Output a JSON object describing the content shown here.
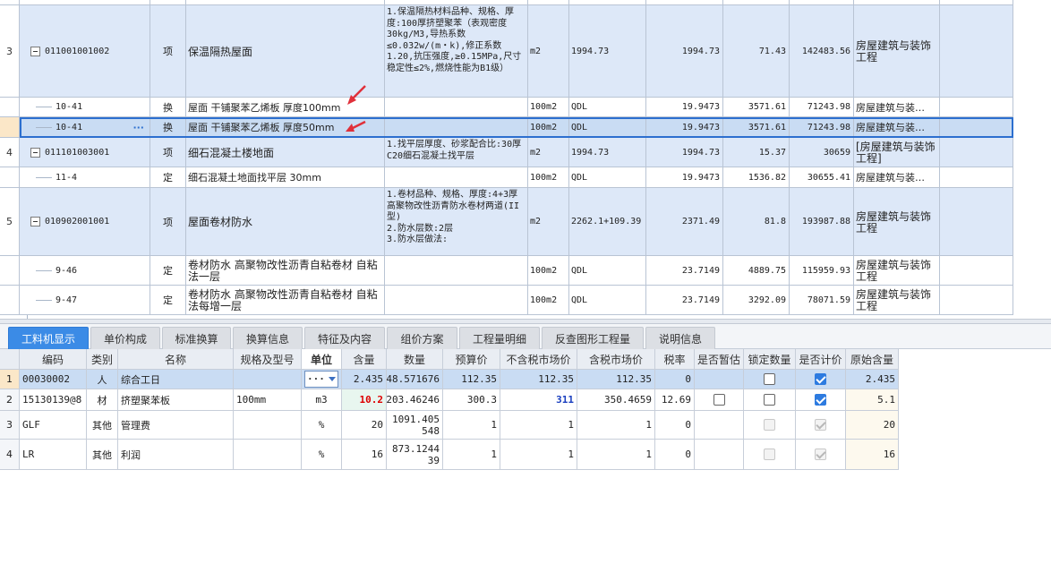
{
  "top_grid": {
    "rows": [
      {
        "idx": "",
        "code": "",
        "type": "",
        "name": "",
        "desc": "",
        "unit": "",
        "qty_expr": "",
        "qty": "",
        "price": "",
        "total": "",
        "major": ""
      },
      {
        "idx": "3",
        "code": "011001001002",
        "type": "项",
        "name": "保温隔热屋面",
        "desc": "1.保温隔热材料品种、规格、厚度:100厚挤塑聚苯（表观密度30kg/M3,导热系数≤0.032w/(m・k),修正系数1.20,抗压强度,≥0.15MPa,尺寸稳定性≤2%,燃烧性能为B1级）",
        "unit": "m2",
        "qty_expr": "1994.73",
        "qty": "1994.73",
        "price": "71.43",
        "total": "142483.56",
        "major": "房屋建筑与装饰工程"
      },
      {
        "idx": "",
        "code": "10-41",
        "type": "换",
        "name": "屋面 干铺聚苯乙烯板 厚度100mm",
        "desc": "",
        "unit": "100m2",
        "qty_expr": "QDL",
        "qty": "19.9473",
        "price": "3571.61",
        "total": "71243.98",
        "major": "房屋建筑与装…"
      },
      {
        "idx": "",
        "code": "10-41",
        "type": "换",
        "name": "屋面 干铺聚苯乙烯板 厚度50mm",
        "desc": "",
        "unit": "100m2",
        "qty_expr": "QDL",
        "qty": "19.9473",
        "price": "3571.61",
        "total": "71243.98",
        "major": "房屋建筑与装…",
        "ellipsis": "···"
      },
      {
        "idx": "4",
        "code": "011101003001",
        "type": "项",
        "name": "细石混凝土楼地面",
        "desc": "1.找平层厚度、砂浆配合比:30厚C20细石混凝土找平层",
        "unit": "m2",
        "qty_expr": "1994.73",
        "qty": "1994.73",
        "price": "15.37",
        "total": "30659",
        "major": "[房屋建筑与装饰工程]"
      },
      {
        "idx": "",
        "code": "11-4",
        "type": "定",
        "name": "细石混凝土地面找平层 30mm",
        "desc": "",
        "unit": "100m2",
        "qty_expr": "QDL",
        "qty": "19.9473",
        "price": "1536.82",
        "total": "30655.41",
        "major": "房屋建筑与装…"
      },
      {
        "idx": "5",
        "code": "010902001001",
        "type": "项",
        "name": "屋面卷材防水",
        "desc": "1.卷材品种、规格、厚度:4+3厚高聚物改性沥青防水卷材两道(II型)\n2.防水层数:2层\n3.防水层做法:",
        "unit": "m2",
        "qty_expr": "2262.1+109.39",
        "qty": "2371.49",
        "price": "81.8",
        "total": "193987.88",
        "major": "房屋建筑与装饰工程"
      },
      {
        "idx": "",
        "code": "9-46",
        "type": "定",
        "name": "卷材防水 高聚物改性沥青自粘卷材 自粘法一层",
        "desc": "",
        "unit": "100m2",
        "qty_expr": "QDL",
        "qty": "23.7149",
        "price": "4889.75",
        "total": "115959.93",
        "major": "房屋建筑与装饰工程"
      },
      {
        "idx": "",
        "code": "9-47",
        "type": "定",
        "name": "卷材防水 高聚物改性沥青自粘卷材 自粘法每增一层",
        "desc": "",
        "unit": "100m2",
        "qty_expr": "QDL",
        "qty": "23.7149",
        "price": "3292.09",
        "total": "78071.59",
        "major": "房屋建筑与装饰工程"
      }
    ]
  },
  "tabs": [
    {
      "label": "工料机显示",
      "active": true
    },
    {
      "label": "单价构成"
    },
    {
      "label": "标准换算"
    },
    {
      "label": "换算信息"
    },
    {
      "label": "特征及内容"
    },
    {
      "label": "组价方案"
    },
    {
      "label": "工程量明细"
    },
    {
      "label": "反查图形工程量"
    },
    {
      "label": "说明信息"
    }
  ],
  "bottom_grid": {
    "headers": [
      "编码",
      "类别",
      "名称",
      "规格及型号",
      "单位",
      "含量",
      "数量",
      "预算价",
      "不含税市场价",
      "含税市场价",
      "税率",
      "是否暂估",
      "锁定数量",
      "是否计价",
      "原始含量"
    ],
    "unit_dropdown": "···",
    "rows": [
      {
        "idx": "1",
        "code": "00030002",
        "cat": "人",
        "name": "综合工日",
        "spec": "",
        "unit": "",
        "content": "2.435",
        "qty": "48.571676",
        "budget": "112.35",
        "mkt_ex": "112.35",
        "mkt_in": "112.35",
        "tax": "0",
        "est": null,
        "lock": false,
        "priced": true,
        "orig": "2.435"
      },
      {
        "idx": "2",
        "code": "15130139@8",
        "cat": "材",
        "name": "挤塑聚苯板",
        "spec": "100mm",
        "unit": "m3",
        "content": "10.2",
        "qty": "203.46246",
        "budget": "300.3",
        "mkt_ex": "311",
        "mkt_in": "350.4659",
        "tax": "12.69",
        "est": false,
        "lock": false,
        "priced": true,
        "orig": "5.1"
      },
      {
        "idx": "3",
        "code": "GLF",
        "cat": "其他",
        "name": "管理费",
        "spec": "",
        "unit": "%",
        "content": "20",
        "qty": "1091.405548",
        "budget": "1",
        "mkt_ex": "1",
        "mkt_in": "1",
        "tax": "0",
        "est": null,
        "lock": false,
        "priced": true,
        "orig": "20"
      },
      {
        "idx": "4",
        "code": "LR",
        "cat": "其他",
        "name": "利润",
        "spec": "",
        "unit": "%",
        "content": "16",
        "qty": "873.124439",
        "budget": "1",
        "mkt_ex": "1",
        "mkt_in": "1",
        "tax": "0",
        "est": null,
        "lock": false,
        "priced": true,
        "orig": "16"
      }
    ]
  },
  "colors": {
    "accent": "#3b8be6",
    "qd_row": "#dde8f8",
    "selected": "#c9dcf3",
    "arrow": "#e0303a"
  }
}
